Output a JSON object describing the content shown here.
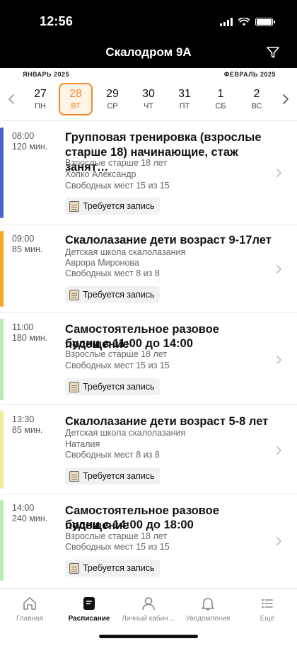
{
  "status": {
    "time": "12:56"
  },
  "nav": {
    "title": "Скалодром 9А",
    "filter_icon": "filter-funnel-icon"
  },
  "calendar": {
    "month_left": "ЯНВАРЬ 2025",
    "month_right": "ФЕВРАЛЬ 2025",
    "days": [
      {
        "num": "27",
        "dow": "ПН"
      },
      {
        "num": "28",
        "dow": "ВТ"
      },
      {
        "num": "29",
        "dow": "СР"
      },
      {
        "num": "30",
        "dow": "ЧТ"
      },
      {
        "num": "31",
        "dow": "ПТ"
      },
      {
        "num": "1",
        "dow": "СБ"
      },
      {
        "num": "2",
        "dow": "ВС"
      }
    ],
    "selected_index": 1,
    "accent_color": "#f08a24"
  },
  "sessions": [
    {
      "time": "08:00",
      "duration": "120 мин.",
      "title_lines": [
        "Групповая тренировка (взрослые",
        "старше 18) начинающие, стаж занят…"
      ],
      "lines": [
        "Взрослые старше 18 лет",
        "Хопко Александр",
        "Свободных мест 15 из 15"
      ],
      "badge": "Требуется запись",
      "color": "#4a63c8"
    },
    {
      "time": "09:00",
      "duration": "85 мин.",
      "title_lines": [
        "Скалолазание дети возраст 9-17лет"
      ],
      "lines": [
        "Детская школа скалолазания",
        "Аврора Миронова",
        "Свободных мест 8 из 8"
      ],
      "badge": "Требуется запись",
      "color": "#f5a623"
    },
    {
      "time": "11:00",
      "duration": "180 мин.",
      "title_lines": [
        "Самостоятельное разовое посещение",
        "будни с 11:00 до 14:00"
      ],
      "lines": [
        "Взрослые старше 18 лет",
        "Свободных мест 15 из 15"
      ],
      "badge": "Требуется запись",
      "color": "#b6ecb0"
    },
    {
      "time": "13:30",
      "duration": "85 мин.",
      "title_lines": [
        "Скалолазание дети возраст 5-8 лет"
      ],
      "lines": [
        "Детская школа скалолазания",
        "Наталия",
        "Свободных мест 8 из 8"
      ],
      "badge": "Требуется запись",
      "color": "#f5ec9a"
    },
    {
      "time": "14:00",
      "duration": "240 мин.",
      "title_lines": [
        "Самостоятельное разовое посещение",
        "будни с 14:00 до 18:00"
      ],
      "lines": [
        "Взрослые старше 18 лет",
        "Свободных мест 15 из 15"
      ],
      "badge": "Требуется запись",
      "color": "#b6ecb0"
    }
  ],
  "tabbar": {
    "tabs": [
      {
        "label": "Главная",
        "icon": "home-icon"
      },
      {
        "label": "Расписание",
        "icon": "schedule-icon"
      },
      {
        "label": "Личный кабин…",
        "icon": "person-icon"
      },
      {
        "label": "Уведомления",
        "icon": "bell-icon"
      },
      {
        "label": "Ещё",
        "icon": "more-list-icon"
      }
    ],
    "active_index": 1
  }
}
